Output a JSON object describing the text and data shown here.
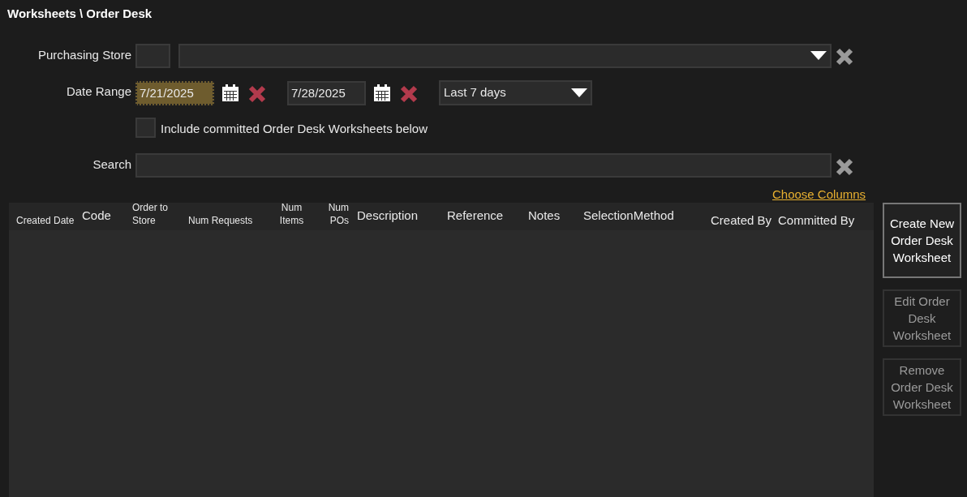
{
  "title": "Worksheets \\ Order Desk",
  "purchasing_store": {
    "label": "Purchasing Store"
  },
  "date_range": {
    "label": "Date Range",
    "start": {
      "value": "7/21/2025",
      "focused": true
    },
    "end": {
      "value": "7/28/2025",
      "focused": false
    },
    "preset": "Last 7 days"
  },
  "include_committed": {
    "label": "Include committed Order Desk Worksheets below",
    "checked": false
  },
  "search": {
    "label": "Search"
  },
  "choose_columns": "Choose Columns",
  "columns": [
    {
      "label": "Created Date",
      "kind": "compact"
    },
    {
      "label": "Code",
      "kind": "standard"
    },
    {
      "label": "Order to Store",
      "kind": "compact"
    },
    {
      "label": "Num Requests",
      "kind": "compact"
    },
    {
      "label": "Num Items",
      "kind": "compact"
    },
    {
      "label": "Num POs",
      "kind": "compact"
    },
    {
      "label": "Description",
      "kind": "standard"
    },
    {
      "label": "Reference",
      "kind": "standard"
    },
    {
      "label": "Notes",
      "kind": "standard"
    },
    {
      "label": "SelectionMethod",
      "kind": "standard"
    },
    {
      "label": "Created By",
      "kind": "standard"
    },
    {
      "label": "Committed By",
      "kind": "standard"
    }
  ],
  "buttons": [
    {
      "label": "Create New Order Desk Worksheet",
      "disabled": false
    },
    {
      "label": "Edit Order Desk Worksheet",
      "disabled": true
    },
    {
      "label": "Remove Order Desk Worksheet",
      "disabled": true
    }
  ]
}
